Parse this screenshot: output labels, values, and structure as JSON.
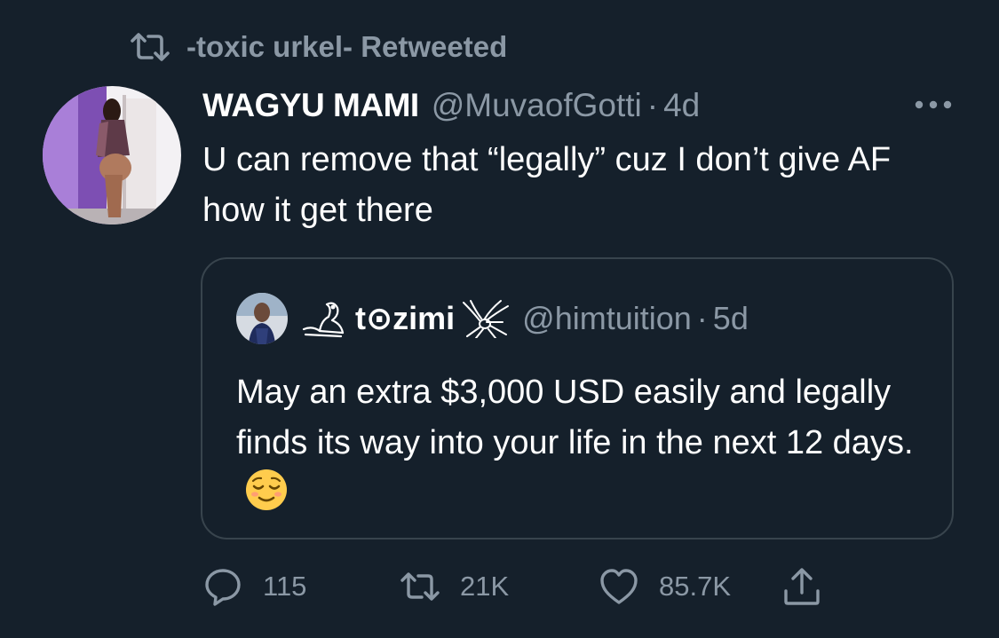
{
  "social_context": {
    "label": "-toxic urkel- Retweeted",
    "icon": "retweet-icon"
  },
  "tweet": {
    "display_name": "WAGYU MAMI",
    "handle": "@MuvaofGotti",
    "separator": "·",
    "time": "4d",
    "text": "U can remove that “legally” cuz I don’t give AF how it get there",
    "more_icon": "more-dots-icon"
  },
  "quote": {
    "name_prefix_icon": "swan-drawing-icon",
    "display_name": "t⊙zimi",
    "name_suffix_icon": "mosquito-drawing-icon",
    "handle": "@himtuition",
    "separator": "·",
    "time": "5d",
    "text": "May an extra $3,000 USD easily and legally finds its way into your life in the next 12 days.",
    "emoji": "relieved-face-emoji"
  },
  "actions": {
    "reply_count": "115",
    "retweet_count": "21K",
    "like_count": "85.7K",
    "reply_icon": "reply-bubble-icon",
    "retweet_icon": "retweet-icon",
    "like_icon": "heart-icon",
    "share_icon": "share-icon"
  },
  "colors": {
    "background": "#15202b",
    "text_primary": "#ffffff",
    "text_secondary": "#8b98a5",
    "border": "#38444d"
  }
}
